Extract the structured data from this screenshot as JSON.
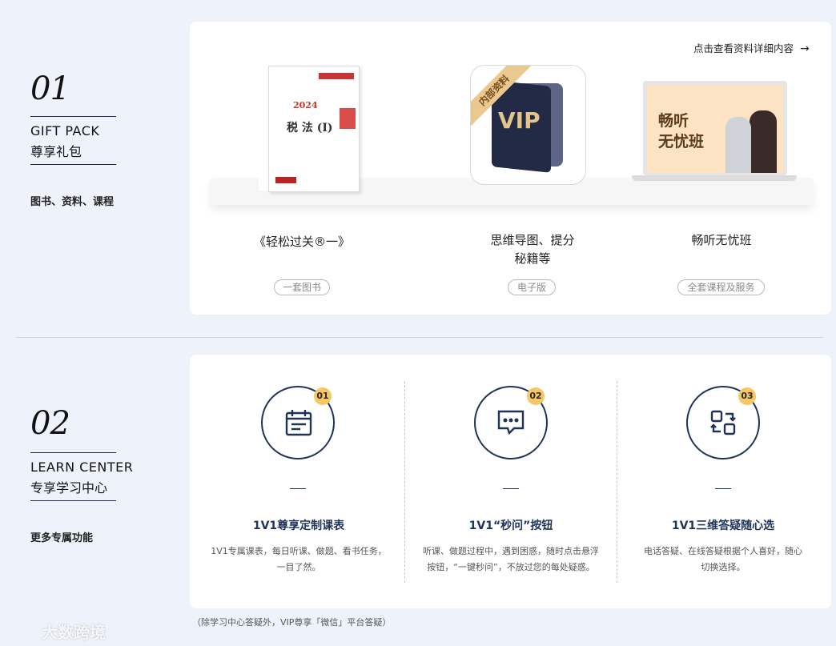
{
  "gift": {
    "number": "01",
    "en_title": "GIFT PACK",
    "cn_title": "尊享礼包",
    "subtitle": "图书、资料、课程",
    "detail_link": "点击查看资料详细内容",
    "items": [
      {
        "title": "《轻松过关®一》",
        "tag": "一套图书"
      },
      {
        "title": "思维导图、提分",
        "title2": "秘籍等",
        "tag": "电子版"
      },
      {
        "title": "畅听无忧班",
        "tag": "全套课程及服务"
      }
    ],
    "book": {
      "year": "2024",
      "title": "税 法 (I)"
    },
    "vip": {
      "ribbon": "内部资料",
      "label": "VIP"
    },
    "laptop": {
      "line1": "畅听",
      "line2": "无忧班"
    }
  },
  "learn": {
    "number": "02",
    "en_title": "LEARN CENTER",
    "cn_title": "专享学习中心",
    "subtitle": "更多专属功能",
    "features": [
      {
        "badge": "01",
        "icon": "calendar-icon",
        "title": "1V1尊享定制课表",
        "desc1": "1V1专属课表，每日听课、做题、看书任务，",
        "desc2": "一目了然。"
      },
      {
        "badge": "02",
        "icon": "chat-bubble-icon",
        "title": "1V1“秒问”按钮",
        "desc1": "听课、做题过程中，遇到困惑，随时点击悬浮",
        "desc2": "按钮，“一键秒问”，不放过您的每处疑惑。"
      },
      {
        "badge": "03",
        "icon": "switch-icon",
        "title": "1V1三维答疑随心选",
        "desc1": "电话答疑、在线答疑根据个人喜好，随心",
        "desc2": "切换选择。"
      }
    ],
    "footnote": "（除学习中心答疑外，VIP尊享「微信」平台答疑）"
  },
  "watermark": "大数跨境",
  "colors": {
    "accent": "#1f3358",
    "badge": "#f5c766",
    "background": "#eef3fb"
  }
}
